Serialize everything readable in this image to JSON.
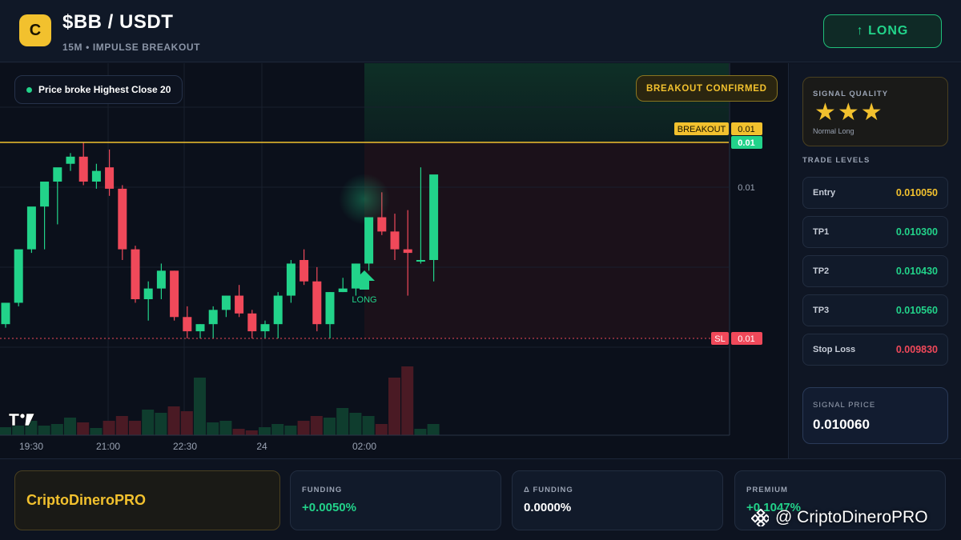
{
  "header": {
    "logo_letter": "C",
    "pair": "$BB / USDT",
    "subtitle": "15M • IMPULSE BREAKOUT",
    "long_button": "↑ LONG"
  },
  "chart": {
    "info_pill": "Price broke Highest Close 20",
    "confirm_badge": "BREAKOUT CONFIRMED",
    "breakout_label": "BREAKOUT",
    "breakout_price": "0.01",
    "current_price": "0.01",
    "axis_price": "0.01",
    "sl_label": "SL",
    "sl_price": "0.01",
    "long_marker": "LONG",
    "time_labels": [
      "19:30",
      "21:00",
      "22:30",
      "24",
      "02:00"
    ],
    "colors": {
      "up": "#22d38a",
      "down": "#f0495a",
      "breakout": "#f2c12e",
      "sl": "#f0495a"
    }
  },
  "chart_data": {
    "type": "candlestick",
    "x": [
      "19:30",
      "21:00",
      "22:30",
      "24",
      "02:00"
    ],
    "series": [
      {
        "values": [
          [
            0.04,
            0.03,
            0.06,
            0.1
          ],
          [
            0.1,
            0.12,
            0.09,
            0.25
          ],
          [
            0.25,
            0.28,
            0.24,
            0.37
          ],
          [
            0.37,
            0.39,
            0.25,
            0.44
          ],
          [
            0.44,
            0.46,
            0.32,
            0.48
          ],
          [
            0.49,
            0.52,
            0.47,
            0.51
          ],
          [
            0.51,
            0.55,
            0.43,
            0.44
          ],
          [
            0.44,
            0.49,
            0.42,
            0.47
          ],
          [
            0.48,
            0.53,
            0.4,
            0.42
          ],
          [
            0.42,
            0.43,
            0.22,
            0.25
          ],
          [
            0.25,
            0.26,
            0.1,
            0.11
          ],
          [
            0.11,
            0.16,
            0.05,
            0.14
          ],
          [
            0.14,
            0.21,
            0.11,
            0.19
          ],
          [
            0.19,
            0.19,
            0.05,
            0.06
          ],
          [
            0.06,
            0.09,
            0.0,
            0.02
          ],
          [
            0.02,
            0.04,
            0.0,
            0.04
          ],
          [
            0.04,
            0.09,
            0.0,
            0.08
          ],
          [
            0.08,
            0.12,
            0.06,
            0.12
          ],
          [
            0.12,
            0.15,
            0.06,
            0.07
          ],
          [
            0.07,
            0.08,
            0.0,
            0.02
          ],
          [
            0.02,
            0.05,
            0.0,
            0.04
          ],
          [
            0.04,
            0.13,
            0.0,
            0.12
          ],
          [
            0.12,
            0.22,
            0.1,
            0.21
          ],
          [
            0.22,
            0.25,
            0.15,
            0.16
          ],
          [
            0.16,
            0.2,
            0.02,
            0.04
          ],
          [
            0.04,
            0.13,
            0.0,
            0.13
          ],
          [
            0.13,
            0.17,
            0.13,
            0.14
          ],
          [
            0.14,
            0.21,
            0.12,
            0.21
          ],
          [
            0.21,
            0.34,
            0.19,
            0.34
          ],
          [
            0.34,
            0.41,
            0.29,
            0.3
          ],
          [
            0.3,
            0.35,
            0.22,
            0.25
          ],
          [
            0.25,
            0.36,
            0.12,
            0.24
          ],
          [
            0.22,
            0.48,
            0.21,
            0.22
          ],
          [
            0.22,
            0.42,
            0.16,
            0.46
          ]
        ]
      }
    ],
    "volume": [
      0.1,
      0.12,
      0.18,
      0.12,
      0.14,
      0.22,
      0.16,
      0.09,
      0.18,
      0.24,
      0.18,
      0.32,
      0.28,
      0.36,
      0.3,
      0.72,
      0.16,
      0.18,
      0.08,
      0.06,
      0.1,
      0.14,
      0.12,
      0.18,
      0.24,
      0.22,
      0.34,
      0.28,
      0.24,
      0.14,
      0.72,
      0.86,
      0.08,
      0.14
    ],
    "levels": {
      "breakout": 0.01,
      "stop_loss": 0.01
    }
  },
  "sidebar": {
    "quality_label": "SIGNAL QUALITY",
    "stars": "★★★",
    "quality_text": "Normal Long",
    "levels_title": "TRADE LEVELS",
    "levels": [
      {
        "label": "Entry",
        "value": "0.010050",
        "color": "#f2c12e"
      },
      {
        "label": "TP1",
        "value": "0.010300",
        "color": "#22d38a"
      },
      {
        "label": "TP2",
        "value": "0.010430",
        "color": "#22d38a"
      },
      {
        "label": "TP3",
        "value": "0.010560",
        "color": "#22d38a"
      },
      {
        "label": "Stop Loss",
        "value": "0.009830",
        "color": "#f0495a"
      }
    ],
    "signal_label": "SIGNAL PRICE",
    "signal_price": "0.010060"
  },
  "footer": {
    "brand": "CriptoDineroPRO",
    "stats": [
      {
        "label": "FUNDING",
        "value": "+0.0050%",
        "color": "#22d38a"
      },
      {
        "label": "Δ FUNDING",
        "value": "0.0000%",
        "color": "#ffffff"
      },
      {
        "label": "PREMIUM",
        "value": "+0.1047%",
        "color": "#22d38a"
      }
    ],
    "watermark": "@ CriptoDineroPRO"
  }
}
